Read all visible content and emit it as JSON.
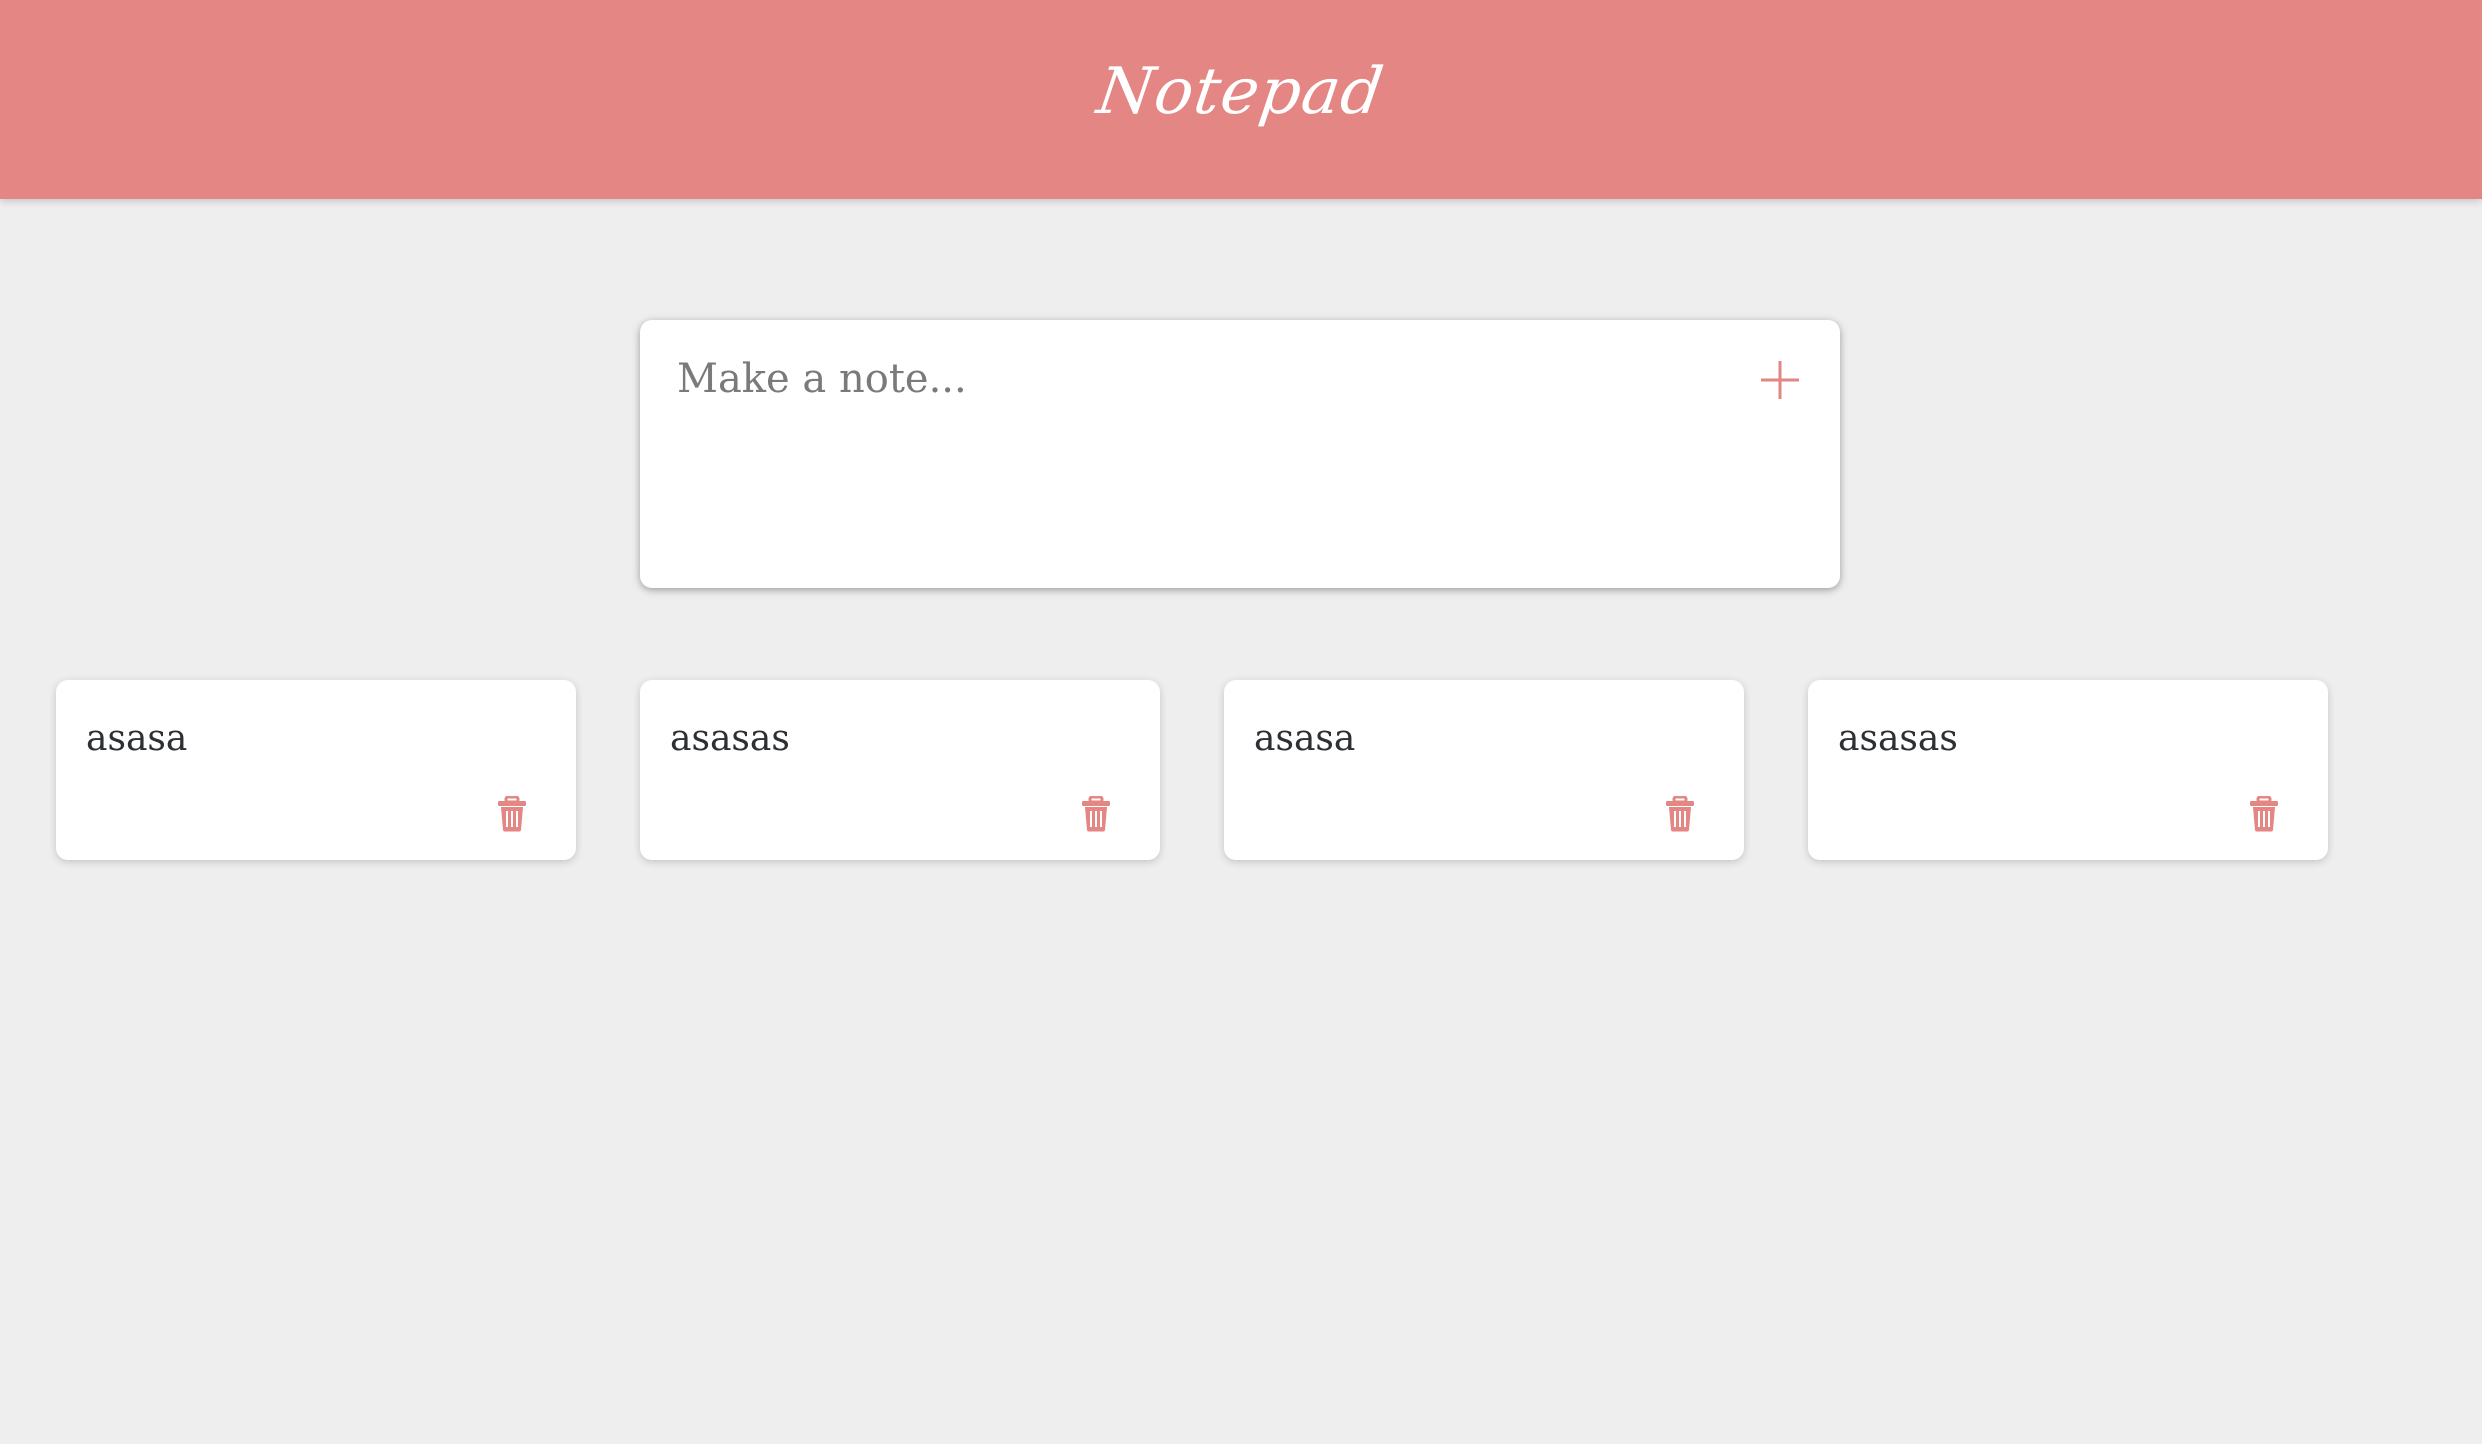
{
  "header": {
    "title": "Notepad",
    "color": "#e48683"
  },
  "composer": {
    "placeholder": "Make a note...",
    "value": "",
    "add_icon": "plus-icon"
  },
  "notes": [
    {
      "text": "asasa",
      "delete_icon": "trash-icon"
    },
    {
      "text": "asasas",
      "delete_icon": "trash-icon"
    },
    {
      "text": "asasa",
      "delete_icon": "trash-icon"
    },
    {
      "text": "asasas",
      "delete_icon": "trash-icon"
    }
  ],
  "colors": {
    "accent": "#e48683",
    "background": "#eeeeee",
    "card": "#ffffff",
    "text": "#2c2f33"
  }
}
